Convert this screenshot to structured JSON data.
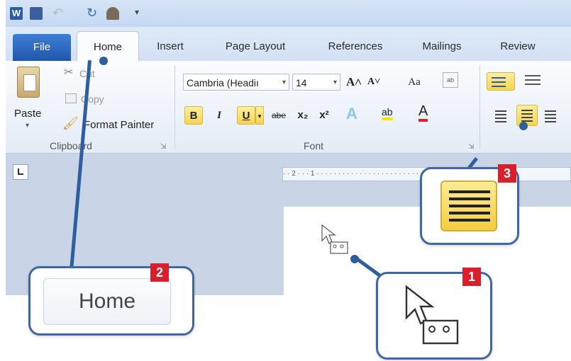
{
  "tabs": {
    "file": "File",
    "home": "Home",
    "insert": "Insert",
    "page_layout": "Page Layout",
    "references": "References",
    "mailings": "Mailings",
    "review": "Review"
  },
  "clipboard": {
    "paste": "Paste",
    "cut": "Cut",
    "copy": "Copy",
    "format_painter": "Format Painter",
    "group_label": "Clipboard"
  },
  "font": {
    "font_name": "Cambria (Headiı",
    "font_size": "14",
    "group_label": "Font",
    "bold": "B",
    "italic": "I",
    "underline": "U",
    "strike": "abe",
    "sub": "x₂",
    "sup": "x²",
    "grow": "A˄",
    "shrink": "A˅",
    "case": "Aa"
  },
  "ruler": {
    "marks": "· · 2 · · · 1 · · · · · · · · · · · · · · · · · · · · · · · · · · · · · · · 4"
  },
  "callouts": {
    "step1": "1",
    "step2": "2",
    "step3": "3",
    "home_zoom": "Home"
  },
  "colors": {
    "accent": "#3f67a6",
    "badge": "#d7202b",
    "highlight": "#f6d44e"
  }
}
